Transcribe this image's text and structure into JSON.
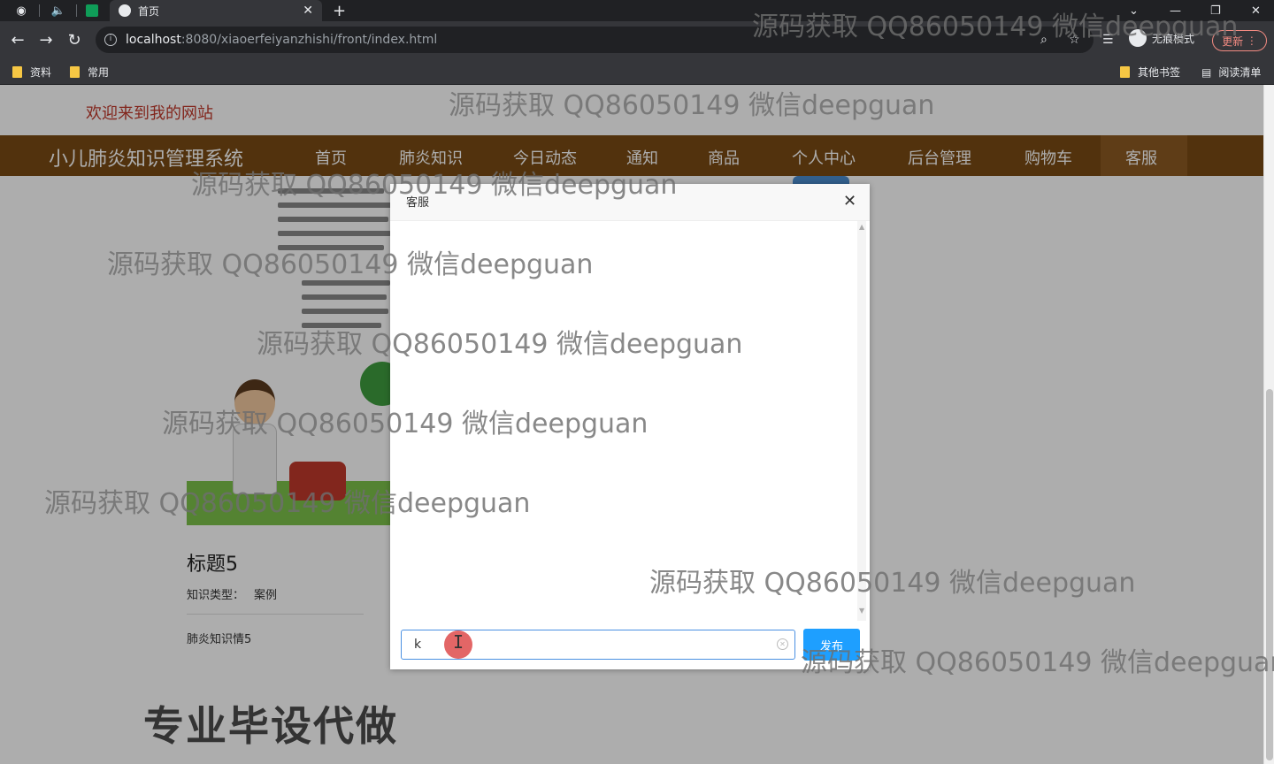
{
  "browser": {
    "tab_title": "首页",
    "new_tab_symbol": "+",
    "url_host": "localhost",
    "url_path": ":8080/xiaoerfeiyanzhishi/front/index.html",
    "incognito_label": "无痕模式",
    "update_label": "更新",
    "bookmarks": [
      "资料",
      "常用"
    ],
    "other_bookmarks": "其他书签",
    "reading_list": "阅读清单"
  },
  "site": {
    "welcome": "欢迎来到我的网站",
    "brand": "小儿肺炎知识管理系统",
    "nav": [
      "首页",
      "肺炎知识",
      "今日动态",
      "通知",
      "商品",
      "个人中心",
      "后台管理",
      "购物车",
      "客服"
    ],
    "active_nav": "客服"
  },
  "card": {
    "title": "标题5",
    "type_label": "知识类型：",
    "type_value": "案例",
    "description": "肺炎知识情5"
  },
  "dialog": {
    "title": "客服",
    "close_symbol": "✕",
    "input_value": "k",
    "send_label": "发布"
  },
  "watermark": "源码获取 QQ86050149 微信deepguan",
  "caption": "专业毕设代做",
  "colors": {
    "nav_bg": "#7a4b14",
    "welcome_text": "#c0392b",
    "send_button": "#1e9fff"
  }
}
